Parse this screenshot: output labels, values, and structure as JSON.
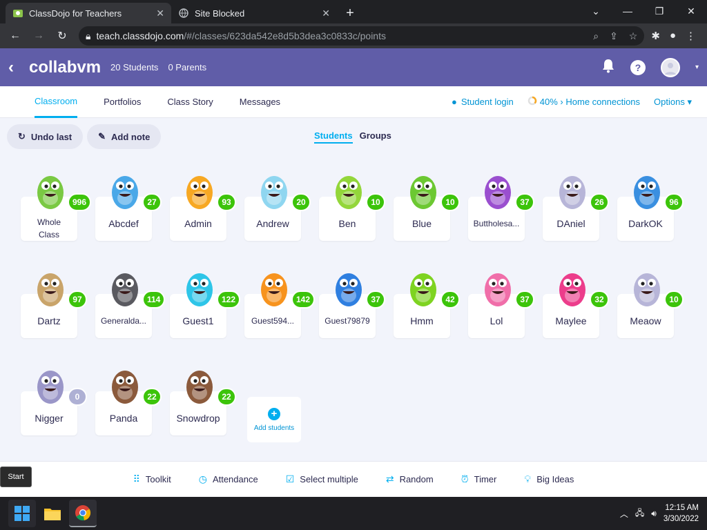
{
  "browser": {
    "tabs": [
      {
        "title": "ClassDojo for Teachers",
        "active": true
      },
      {
        "title": "Site Blocked",
        "active": false
      }
    ],
    "url_host": "teach.classdojo.com",
    "url_path": "/#/classes/623da542e8d5b3dea3c0833c/points"
  },
  "header": {
    "class_name": "collabvm",
    "students": "20 Students",
    "parents": "0 Parents"
  },
  "subnav": {
    "tabs": [
      "Classroom",
      "Portfolios",
      "Class Story",
      "Messages"
    ],
    "student_login": "Student login",
    "home_connections": "40% › Home connections",
    "options": "Options"
  },
  "toolbar": {
    "undo": "Undo last",
    "add_note": "Add note",
    "view_students": "Students",
    "view_groups": "Groups"
  },
  "students": [
    {
      "name": "Whole Class",
      "points": "996",
      "color": "#7ac943"
    },
    {
      "name": "Abcdef",
      "points": "27",
      "color": "#4aa8e8"
    },
    {
      "name": "Admin",
      "points": "93",
      "color": "#f7a823"
    },
    {
      "name": "Andrew",
      "points": "20",
      "color": "#8fd6f0"
    },
    {
      "name": "Ben",
      "points": "10",
      "color": "#93d63a"
    },
    {
      "name": "Blue",
      "points": "10",
      "color": "#6cc832"
    },
    {
      "name": "Buttholesa...",
      "points": "37",
      "color": "#9a4fcf"
    },
    {
      "name": "DAniel",
      "points": "26",
      "color": "#b7b5d8"
    },
    {
      "name": "DarkOK",
      "points": "96",
      "color": "#3a8fe0"
    },
    {
      "name": "Dartz",
      "points": "97",
      "color": "#c9a46a"
    },
    {
      "name": "Generalda...",
      "points": "114",
      "color": "#5a5a60"
    },
    {
      "name": "Guest1",
      "points": "122",
      "color": "#2ec5e8"
    },
    {
      "name": "Guest594...",
      "points": "142",
      "color": "#f7931e"
    },
    {
      "name": "Guest79879",
      "points": "37",
      "color": "#2f7fe0"
    },
    {
      "name": "Hmm",
      "points": "42",
      "color": "#7ed321"
    },
    {
      "name": "Lol",
      "points": "37",
      "color": "#f06ea9"
    },
    {
      "name": "Maylee",
      "points": "32",
      "color": "#ec3d8b"
    },
    {
      "name": "Meaow",
      "points": "10",
      "color": "#b7b5d8"
    },
    {
      "name": "Nigger",
      "points": "0",
      "color": "#9a96c8"
    },
    {
      "name": "Panda",
      "points": "22",
      "color": "#8b5a3c"
    },
    {
      "name": "Snowdrop",
      "points": "22",
      "color": "#8b5a3c"
    }
  ],
  "add_students": "Add students",
  "bottom": {
    "toolkit": "Toolkit",
    "attendance": "Attendance",
    "select_multiple": "Select multiple",
    "random": "Random",
    "timer": "Timer",
    "big_ideas": "Big Ideas"
  },
  "start_tooltip": "Start",
  "clock": {
    "time": "12:15 AM",
    "date": "3/30/2022"
  },
  "colors": {
    "header": "#605da8",
    "accent": "#00aeef",
    "badge": "#3cc40a"
  }
}
